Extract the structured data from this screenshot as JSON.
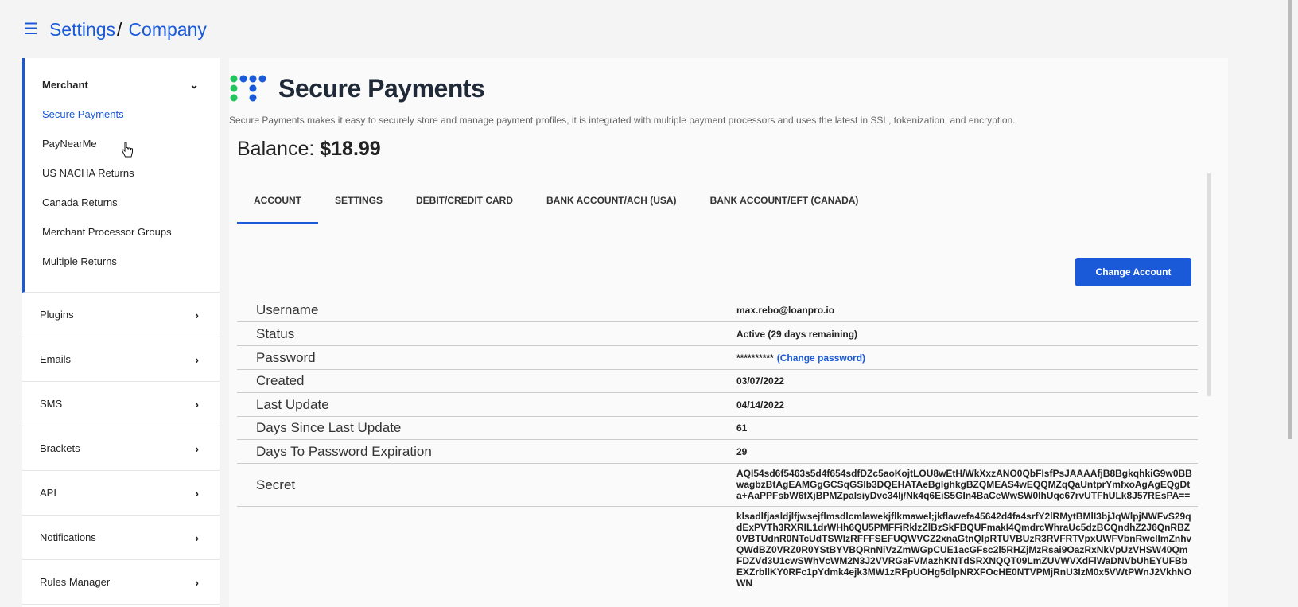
{
  "header": {
    "menu_icon": "hamburger-icon",
    "crumb_settings": "Settings",
    "crumb_sep": "/",
    "crumb_company": "Company"
  },
  "sidebar": {
    "merchant": {
      "label": "Merchant",
      "items": [
        {
          "label": "Secure Payments",
          "active": true
        },
        {
          "label": "PayNearMe"
        },
        {
          "label": "US NACHA Returns"
        },
        {
          "label": "Canada Returns"
        },
        {
          "label": "Merchant Processor Groups"
        },
        {
          "label": "Multiple Returns"
        }
      ]
    },
    "sections": [
      {
        "label": "Plugins"
      },
      {
        "label": "Emails"
      },
      {
        "label": "SMS"
      },
      {
        "label": "Brackets"
      },
      {
        "label": "API"
      },
      {
        "label": "Notifications"
      },
      {
        "label": "Rules Manager"
      }
    ]
  },
  "main": {
    "brand_name": "Secure Payments",
    "description": "Secure Payments makes it easy to securely store and manage payment profiles, it is integrated with multiple payment processors and uses the latest in SSL, tokenization, and encryption.",
    "balance_label": "Balance:",
    "balance_value": "$18.99",
    "tabs": [
      {
        "label": "ACCOUNT",
        "active": true
      },
      {
        "label": "SETTINGS"
      },
      {
        "label": "DEBIT/CREDIT CARD"
      },
      {
        "label": "BANK ACCOUNT/ACH (USA)"
      },
      {
        "label": "BANK ACCOUNT/EFT (CANADA)"
      }
    ],
    "change_account_label": "Change Account",
    "rows": [
      {
        "key": "Username",
        "value": "max.rebo@loanpro.io"
      },
      {
        "key": "Status",
        "value": "Active (29 days remaining)"
      },
      {
        "key": "Password",
        "value": "**********",
        "link": "(Change password)"
      },
      {
        "key": "Created",
        "value": "03/07/2022"
      },
      {
        "key": "Last Update",
        "value": "04/14/2022"
      },
      {
        "key": "Days Since Last Update",
        "value": "61"
      },
      {
        "key": "Days To Password Expiration",
        "value": "29"
      },
      {
        "key": "Secret",
        "value": "AQI54sd6f5463s5d4f654sdfDZc5aoKojtLOU8wEtH/WkXxzANO0QbFIsfPsJAAAAfjB8BgkqhkiG9w0BBwagbzBtAgEAMGgGCSqGSIb3DQEHATAeBglghkgBZQMEAS4wEQQMZqQaUntprYmfxoAgAgEQgDta+AaPPFsbW6fXjBPMZpalsiyDvc34lj/Nk4q6EiS5GIn4BaCeWwSW0IhUqc67rvUTFhULk8J57REsPA=="
      },
      {
        "key": "",
        "value": "klsadlfjasldjlfjwsejflmsdlcmlawekjflkmawel;jkflawefa45642d4fa4srfY2lRMytBMlI3bjJqWlpjNWFvS29qdExPVTh3RXRIL1drWHh6QU5PMFFiRklzZlBzSkFBQUFmakI4QmdrcWhraUc5dzBCQndhZ2J6QnRBZ0VBTUdnR0NTcUdTSWIzRFFFSEFUQWVCZ2xnaGtnQlpRTUVBUzR3RVFRTVpxUWFVbnRwcllmZnhvQWdBZ0VRZ0R0YStBYVBQRnNiVzZmWGpCUE1acGFsc2l5RHZjMzRsai9OazRxNkVpUzVHSW40QmFDZVd3U1cwSWhVcWM2N3J2VVRGaFVMazhKNTdSRXNQQT09LmZUVWVXdFlWaDNVbUhEYUFBbEXZrbllKY0RFc1pYdmk4ejk3MW1zRFpUOHg5dlpNRXFOcHE0NTVPMjRnU3IzM0x5VWtPWnJ2VkhNOWN"
      }
    ]
  },
  "colors": {
    "accent": "#1a5ad8",
    "logo_green": "#22c55e"
  }
}
